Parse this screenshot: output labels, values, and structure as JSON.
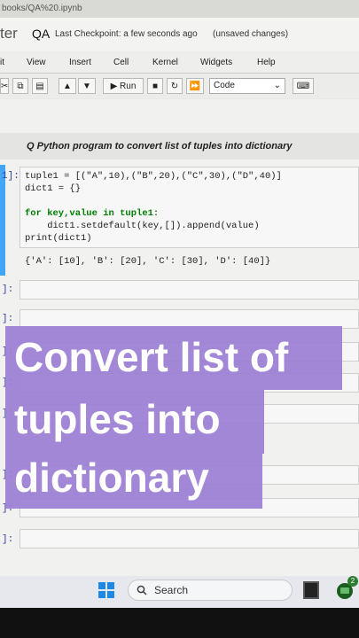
{
  "browser": {
    "url": "books/QA%20.ipynb"
  },
  "header": {
    "logo_text": "ter",
    "notebook_name": "QA",
    "checkpoint": "Last Checkpoint: a few seconds ago",
    "unsaved": "(unsaved changes)"
  },
  "menu": {
    "items": [
      "it",
      "View",
      "Insert",
      "Cell",
      "Kernel",
      "Widgets",
      "Help"
    ]
  },
  "toolbar": {
    "run_label": "Run",
    "cell_type": "Code"
  },
  "notebook": {
    "title": "Q Python program to convert list of tuples into dictionary",
    "cell_prompt": "1]:",
    "code_lines": [
      "tuple1 = [(\"A\",10),(\"B\",20),(\"C\",30),(\"D\",40)]",
      "dict1 = {}",
      "",
      "for key,value in tuple1:",
      "    dict1.setdefault(key,[]).append(value)",
      "print(dict1)"
    ],
    "output": "{'A': [10], 'B': [20], 'C': [30], 'D': [40]}",
    "empty_prompts": [
      "]:",
      "]:",
      "]:",
      "]:",
      "]:",
      "]:",
      "]:",
      "]:"
    ]
  },
  "overlay": {
    "lines": [
      "Convert list of",
      "tuples into",
      "dictionary"
    ],
    "color": "#9b7fd4"
  },
  "taskbar": {
    "search_label": "Search",
    "badge": "2"
  }
}
